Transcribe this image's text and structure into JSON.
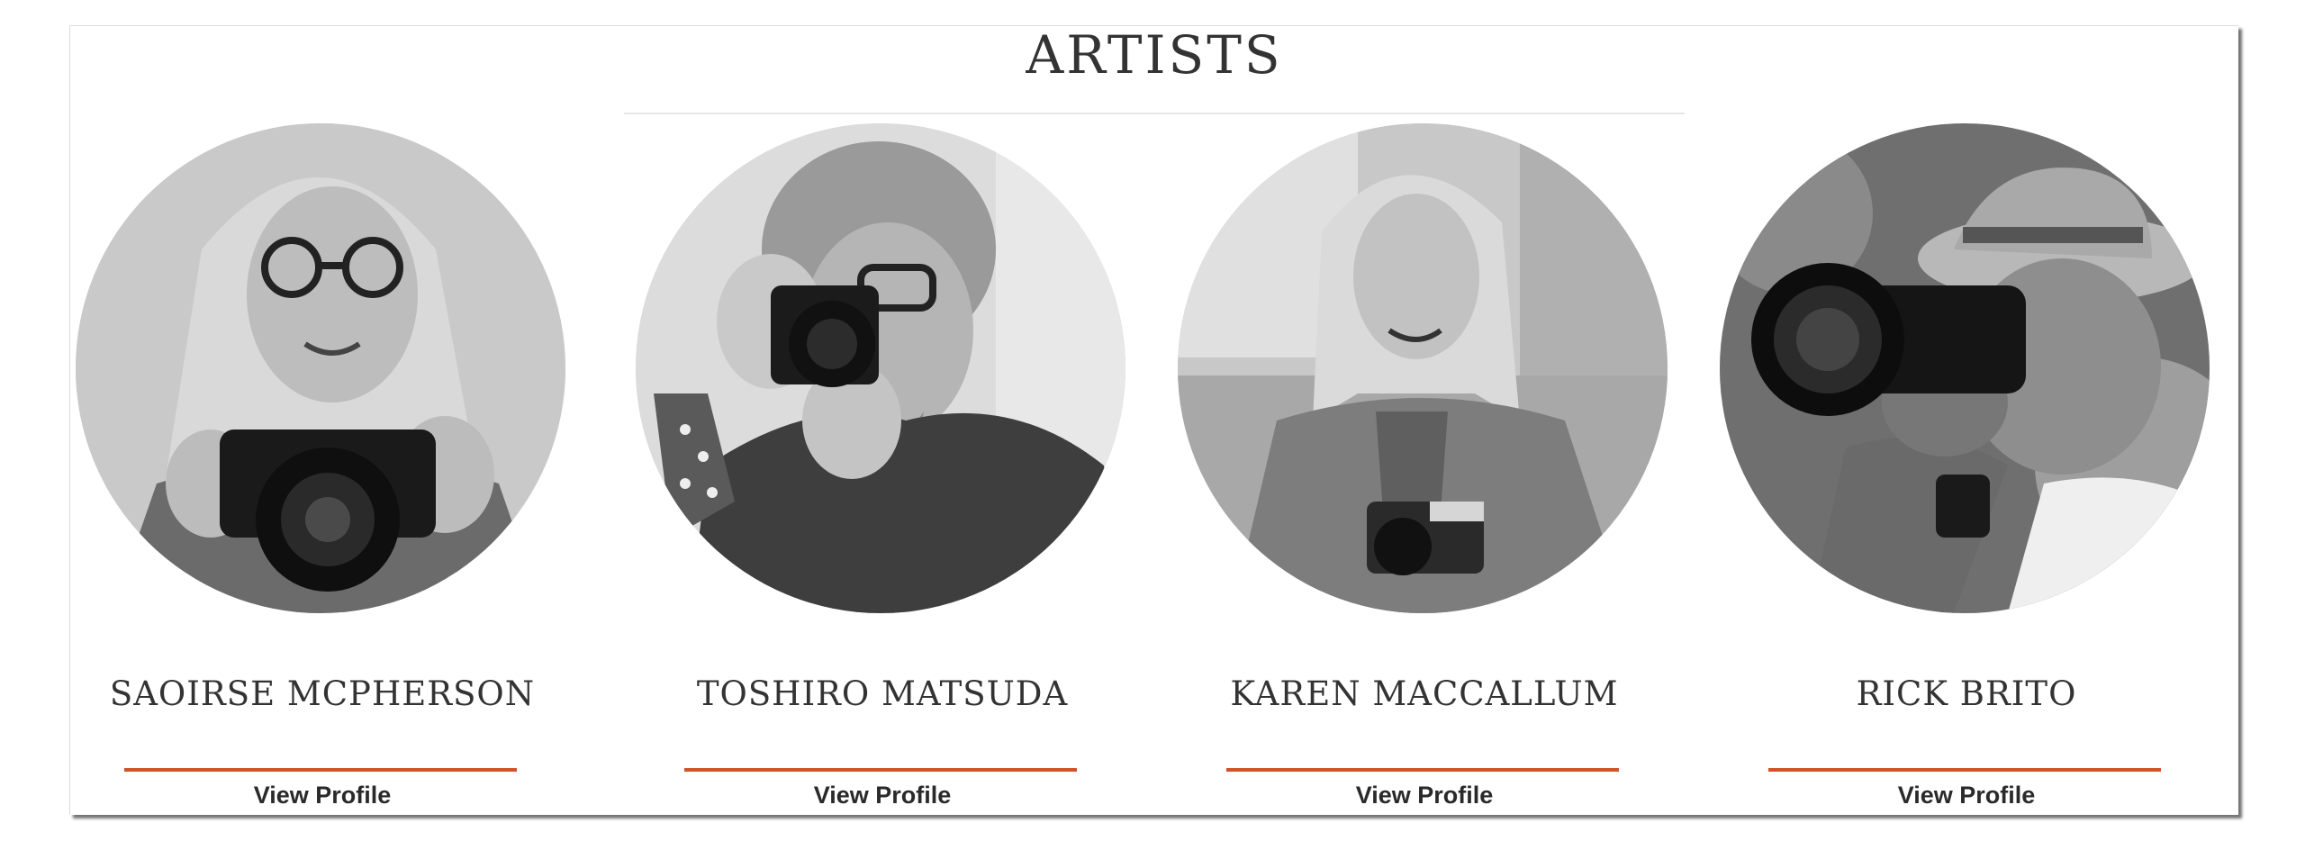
{
  "section": {
    "title": "ARTISTS"
  },
  "artists": [
    {
      "name": "TOSHIRO MATSUDA",
      "link_label": "View Profile"
    },
    {
      "name": "KAREN MACCALLUM",
      "link_label": "View Profile"
    },
    {
      "name": "RICK BRITO",
      "link_label": "View Profile"
    },
    {
      "name": "SAOIRSE MCPHERSON",
      "link_label": "View Profile"
    }
  ],
  "colors": {
    "accent": "#d2532a",
    "text": "#333333",
    "link": "#2a2a2a"
  }
}
